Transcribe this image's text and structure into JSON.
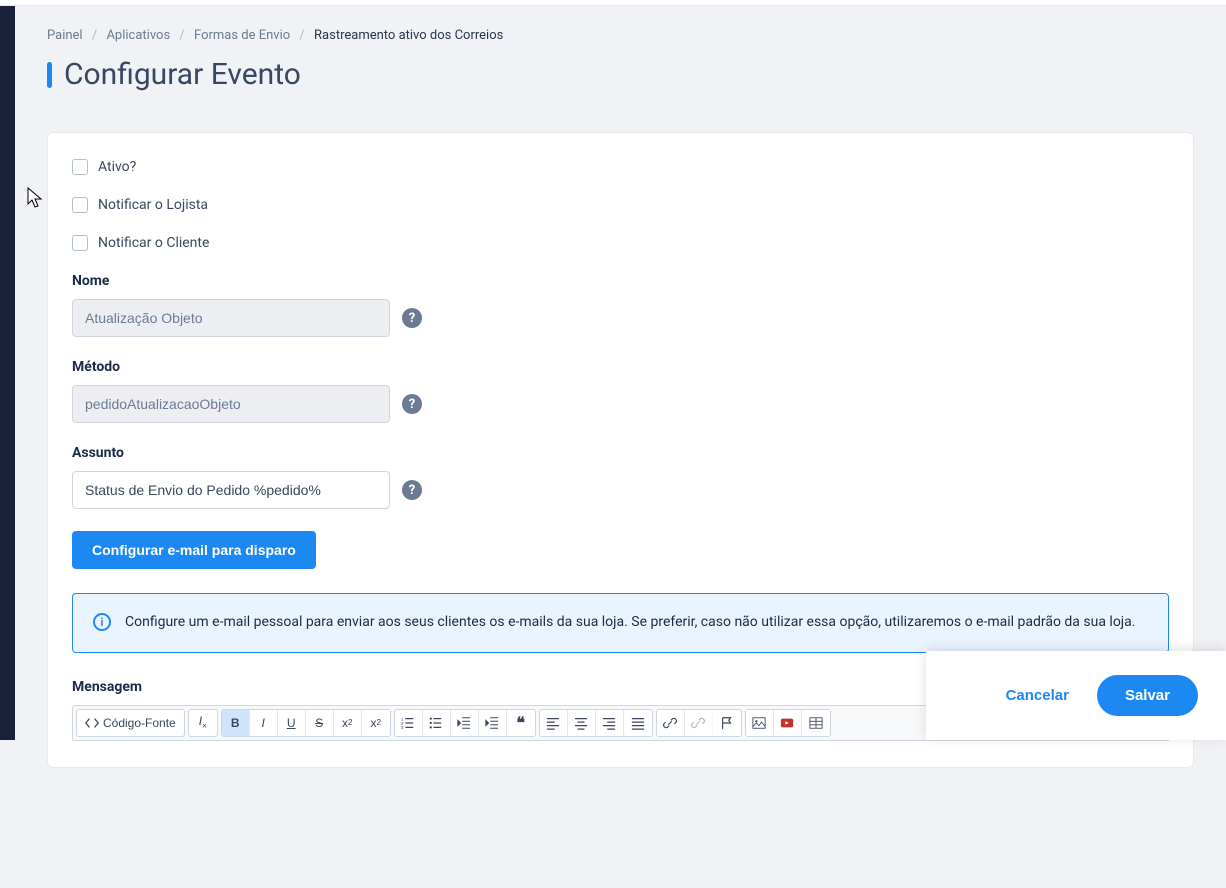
{
  "breadcrumb": {
    "items": [
      "Painel",
      "Aplicativos",
      "Formas de Envio"
    ],
    "current": "Rastreamento ativo dos Correios"
  },
  "page": {
    "title": "Configurar Evento"
  },
  "form": {
    "checks": {
      "ativo": "Ativo?",
      "notificar_lojista": "Notificar o Lojista",
      "notificar_cliente": "Notificar o Cliente"
    },
    "nome": {
      "label": "Nome",
      "value": "Atualização Objeto"
    },
    "metodo": {
      "label": "Método",
      "value": "pedidoAtualizacaoObjeto"
    },
    "assunto": {
      "label": "Assunto",
      "value": "Status de Envio do Pedido %pedido%"
    },
    "btn_config_email": "Configurar e-mail para disparo",
    "info_text": "Configure um e-mail pessoal para enviar aos seus clientes os e-mails da sua loja. Se preferir, caso não utilizar essa opção, utilizaremos o e-mail padrão da sua loja.",
    "mensagem_label": "Mensagem"
  },
  "toolbar": {
    "source_label": "Código-Fonte"
  },
  "footer": {
    "cancel": "Cancelar",
    "save": "Salvar"
  }
}
